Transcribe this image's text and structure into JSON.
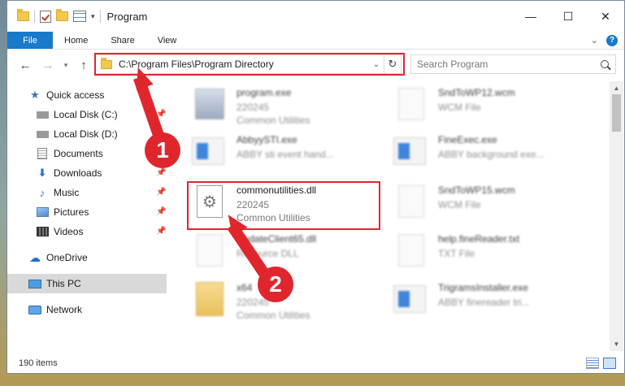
{
  "window": {
    "title": "Program"
  },
  "ribbon": {
    "file": "File",
    "home": "Home",
    "share": "Share",
    "view": "View",
    "help": "?"
  },
  "address": {
    "path": "C:\\Program Files\\Program Directory"
  },
  "search": {
    "placeholder": "Search Program"
  },
  "sidebar": {
    "items": [
      {
        "label": "Quick access",
        "icon": "star-icon"
      },
      {
        "label": "Local Disk (C:)",
        "icon": "disk-icon",
        "pinned": true
      },
      {
        "label": "Local Disk (D:)",
        "icon": "disk-icon",
        "pinned": false
      },
      {
        "label": "Documents",
        "icon": "documents-icon",
        "pinned": true
      },
      {
        "label": "Downloads",
        "icon": "download-icon",
        "pinned": true
      },
      {
        "label": "Music",
        "icon": "music-icon",
        "pinned": true
      },
      {
        "label": "Pictures",
        "icon": "pictures-icon",
        "pinned": true
      },
      {
        "label": "Videos",
        "icon": "videos-icon",
        "pinned": true
      },
      {
        "label": "OneDrive",
        "icon": "cloud-icon"
      },
      {
        "label": "This PC",
        "icon": "pc-icon",
        "selected": true
      },
      {
        "label": "Network",
        "icon": "network-icon"
      }
    ]
  },
  "files": [
    {
      "name": "program.exe",
      "line2": "220245",
      "line3": "Common Utilities",
      "thumb": "exe"
    },
    {
      "name": "SndToWP12.wcm",
      "line2": "WCM File",
      "line3": "",
      "thumb": "page"
    },
    {
      "name": "AbbyySTI.exe",
      "line2": "ABBY sti event hand...",
      "line3": "",
      "thumb": "app"
    },
    {
      "name": "FineExec.exe",
      "line2": "ABBY background exe...",
      "line3": "",
      "thumb": "app"
    },
    {
      "name": "commonutilities.dll",
      "line2": "220245",
      "line3": "Common Utilities",
      "thumb": "dll"
    },
    {
      "name": "SndToWP15.wcm",
      "line2": "WCM File",
      "line3": "",
      "thumb": "page"
    },
    {
      "name": "UpdateClient65.dll",
      "line2": "Resource DLL",
      "line3": "",
      "thumb": "page"
    },
    {
      "name": "help.fineReader.txt",
      "line2": "TXT File",
      "line3": "",
      "thumb": "page"
    },
    {
      "name": "x64",
      "line2": "220245",
      "line3": "Common Utilities",
      "thumb": "folder"
    },
    {
      "name": "TrigramsInstaller.exe",
      "line2": "ABBY finereader tri...",
      "line3": "",
      "thumb": "app"
    }
  ],
  "status": {
    "count": "190 items"
  },
  "annotations": {
    "step1": "1",
    "step2": "2",
    "color": "#e0262d"
  }
}
